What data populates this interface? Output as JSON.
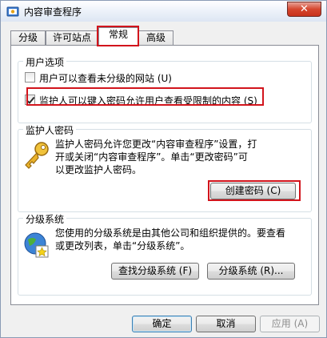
{
  "window": {
    "title": "内容审查程序",
    "close_label": "✕"
  },
  "tabs": [
    {
      "label": "分级"
    },
    {
      "label": "许可站点"
    },
    {
      "label": "常规"
    },
    {
      "label": "高级"
    }
  ],
  "user_options": {
    "title": "用户选项",
    "items": [
      {
        "label": "用户可以查看未分级的网站 (U)",
        "checked": false
      },
      {
        "label": "监护人可以键入密码允许用户查看受限制的内容 (S)",
        "checked": true
      }
    ]
  },
  "supervisor": {
    "title": "监护人密码",
    "line1": "监护人密码允许您更改“内容审查程序”设置，打",
    "line2": "开或关闭“内容审查程序”。单击“更改密码”可",
    "line3": "以更改监护人密码。",
    "button": "创建密码 (C)"
  },
  "rating": {
    "title": "分级系统",
    "line1": "您使用的分级系统是由其他公司和组织提供的。要查看",
    "line2": "或更改列表，单击“分级系统”。",
    "find_button": "查找分级系统 (F)",
    "systems_button": "分级系统 (R)..."
  },
  "footer": {
    "ok": "确定",
    "cancel": "取消",
    "apply": "应用 (A)"
  }
}
